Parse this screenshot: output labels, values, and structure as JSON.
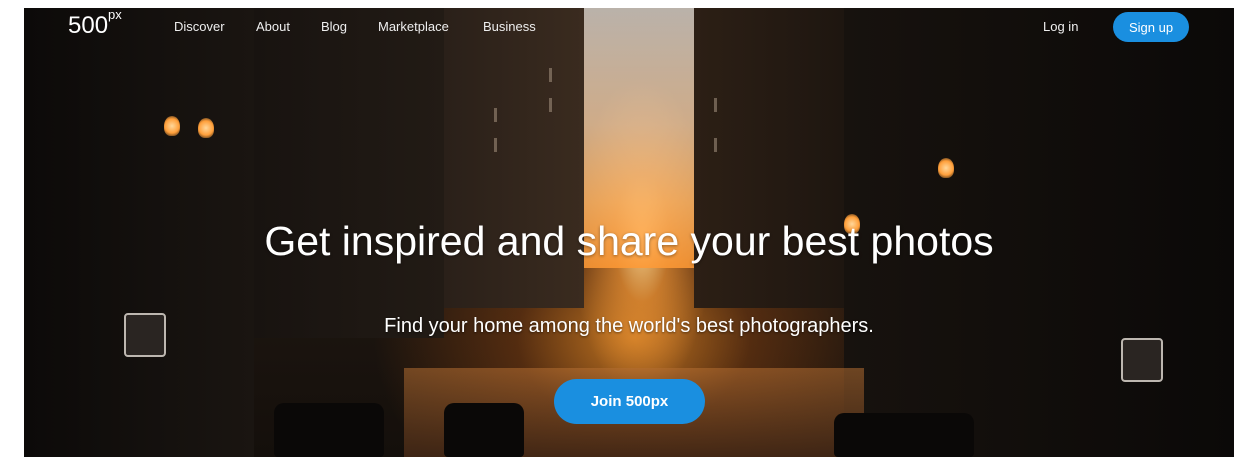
{
  "nav": {
    "logo": "500",
    "logo_sup": "px",
    "links": [
      "Discover",
      "About",
      "Blog",
      "Marketplace",
      "Business"
    ],
    "login": "Log in",
    "signup": "Sign up"
  },
  "hero": {
    "headline": "Get inspired and share your best photos",
    "subheadline": "Find your home among the world's best photographers.",
    "cta": "Join 500px"
  },
  "colors": {
    "accent": "#1a8fe0",
    "text": "#ffffff"
  }
}
